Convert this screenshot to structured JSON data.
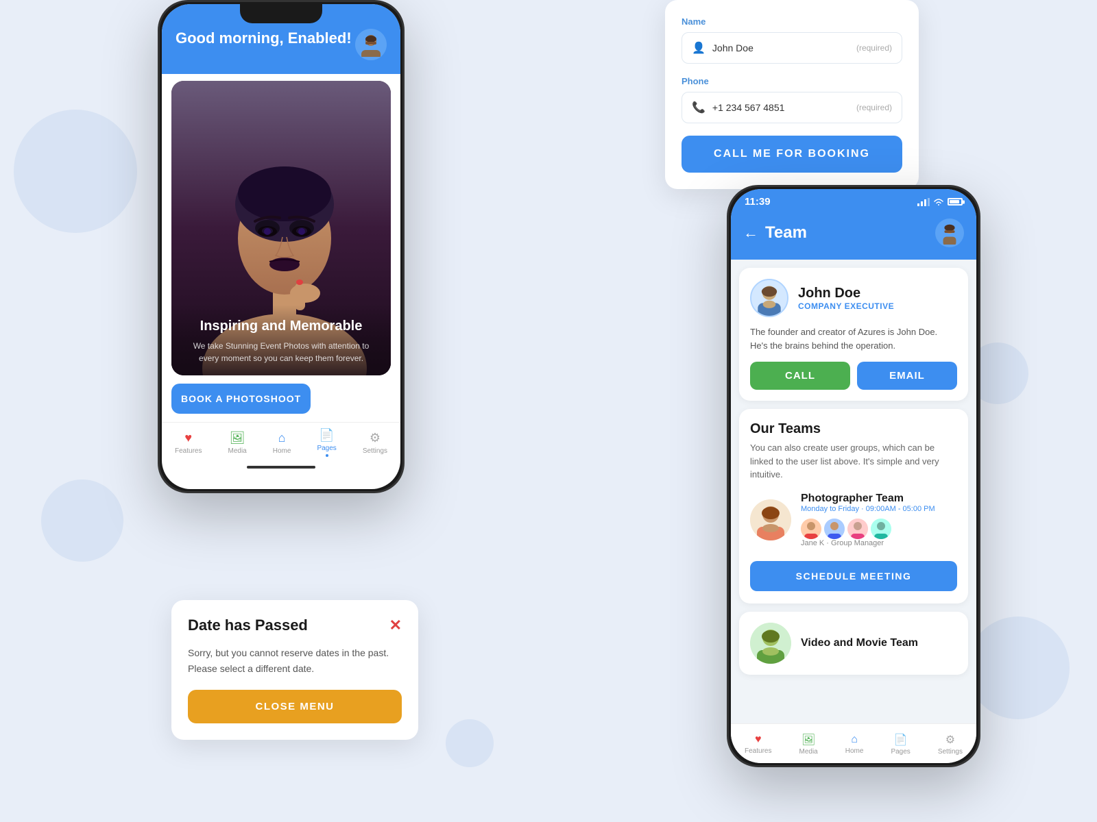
{
  "background": "#e8eef8",
  "phone1": {
    "greeting": "Good morning,\nEnabled!",
    "image_title": "Inspiring and Memorable",
    "image_sub": "We take Stunning Event Photos with attention to every moment so you can keep them forever.",
    "book_btn": "BOOK A PHOTOSHOOT",
    "nav": [
      {
        "label": "Features",
        "icon": "♥",
        "active": false
      },
      {
        "label": "Media",
        "icon": "🖼",
        "active": false
      },
      {
        "label": "Home",
        "icon": "⌂",
        "active": false
      },
      {
        "label": "Pages",
        "icon": "📄",
        "active": true
      },
      {
        "label": "Settings",
        "icon": "⚙",
        "active": false
      }
    ]
  },
  "booking_form": {
    "name_label": "Name",
    "name_placeholder": "John Doe",
    "name_required": "(required)",
    "phone_label": "Phone",
    "phone_placeholder": "+1 234 567 4851",
    "phone_required": "(required)",
    "cta_button": "CALL ME FOR BOOKING"
  },
  "date_passed": {
    "title": "Date has Passed",
    "body": "Sorry, but you cannot reserve dates in the past. Please select a different date.",
    "close_btn": "CLOSE MENU"
  },
  "phone2": {
    "status_time": "11:39",
    "header_title": "Team",
    "member_name": "John Doe",
    "member_role": "COMPANY EXECUTIVE",
    "member_bio": "The founder and creator of Azures is John Doe. He's the brains behind the operation.",
    "call_btn": "CALL",
    "email_btn": "EMAIL",
    "our_teams_title": "Our Teams",
    "our_teams_desc": "You can also create user groups, which can be linked to the user list above. It's simple and very intuitive.",
    "photographer_team_name": "Photographer Team",
    "photographer_team_hours": "Monday to Friday · 09:00AM - 05:00 PM",
    "photographer_manager": "Jane K",
    "photographer_role": "Group Manager",
    "schedule_btn": "SCHEDULE MEETING",
    "video_team_title": "Video and Movie Team"
  }
}
